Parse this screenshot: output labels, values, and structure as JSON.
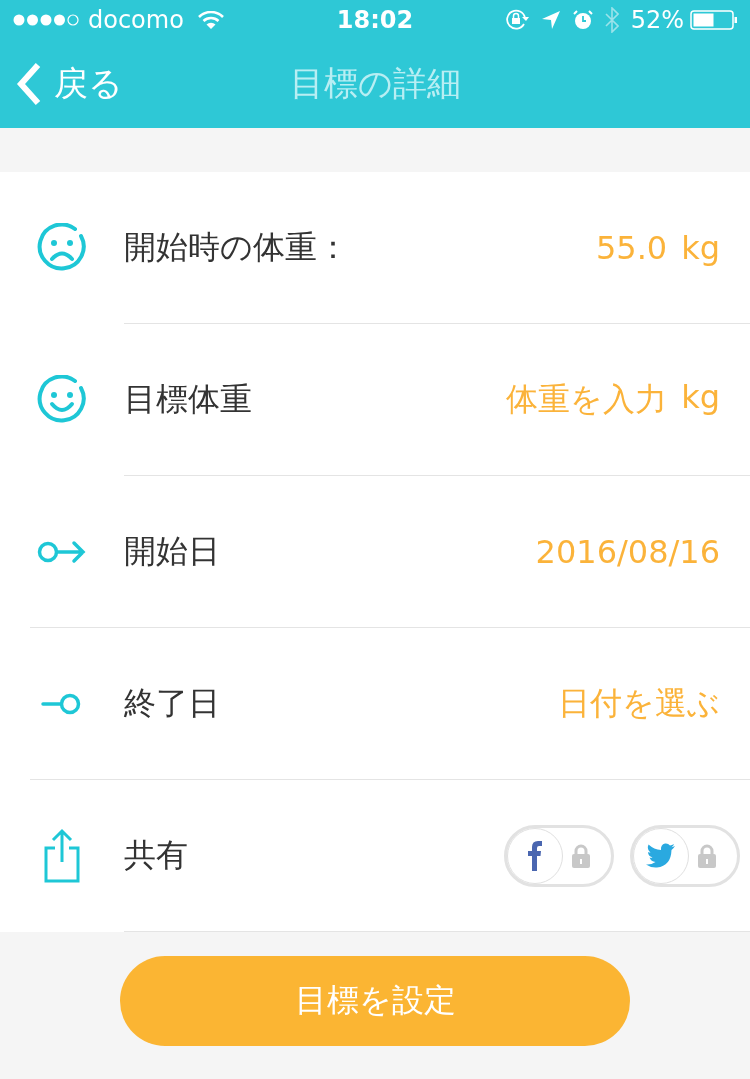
{
  "status_bar": {
    "carrier": "docomo",
    "time": "18:02",
    "battery": "52%"
  },
  "nav": {
    "back": "戻る",
    "title": "目標の詳細"
  },
  "rows": [
    {
      "kind": "start-weight",
      "label": "開始時の体重：",
      "value": "55.0",
      "unit": "kg"
    },
    {
      "kind": "target-weight",
      "label": "目標体重",
      "value": "体重を入力",
      "unit": "kg"
    },
    {
      "kind": "start-date",
      "label": "開始日",
      "value": "2016/08/16"
    },
    {
      "kind": "end-date",
      "label": "終了日",
      "value": "日付を選ぶ"
    },
    {
      "kind": "share",
      "label": "共有",
      "toggles": [
        {
          "kind": "facebook",
          "on": false
        },
        {
          "kind": "twitter",
          "on": false
        }
      ]
    }
  ],
  "button": "目標を設定"
}
